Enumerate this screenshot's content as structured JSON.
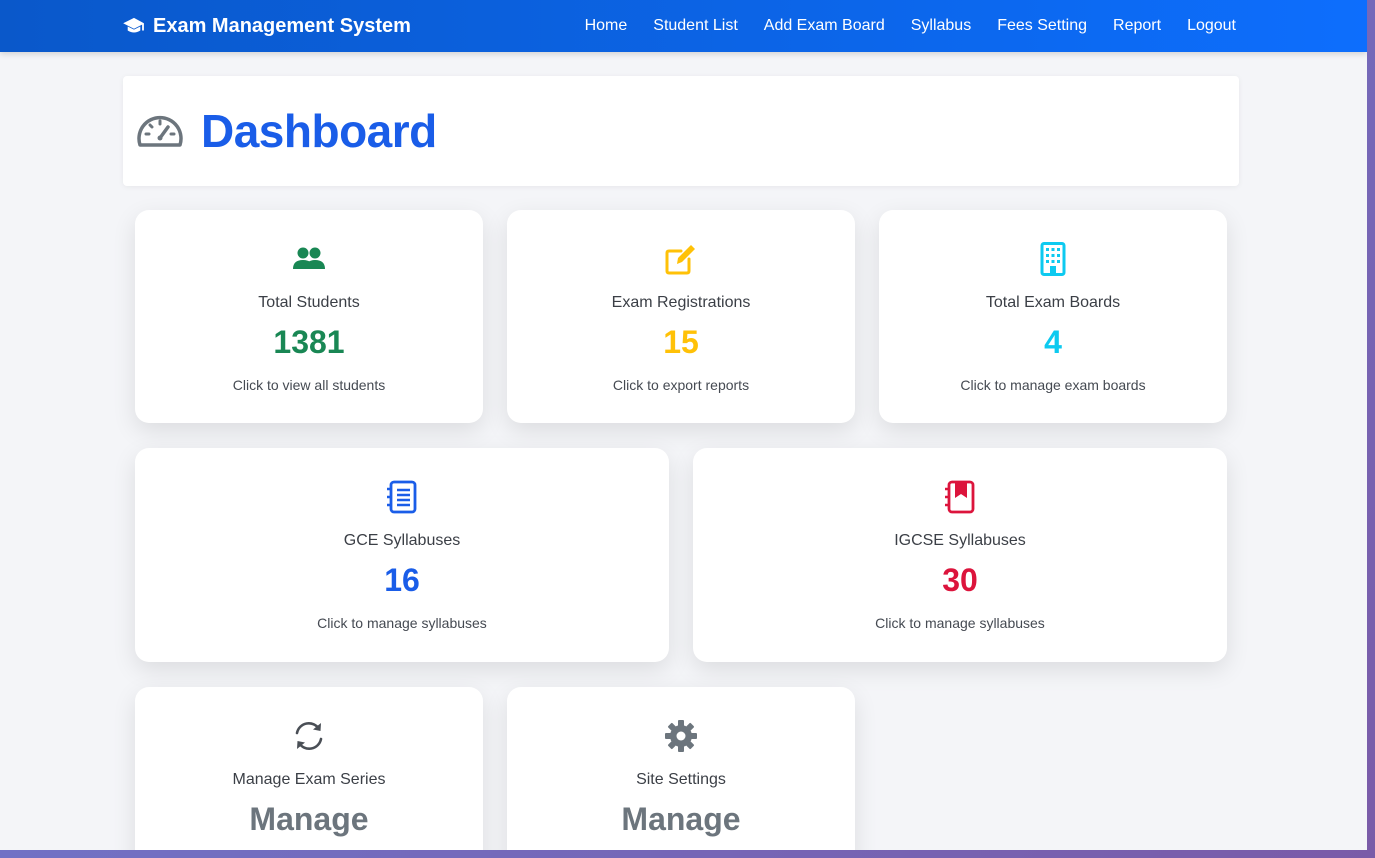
{
  "navbar": {
    "brand": "Exam Management System",
    "links": [
      "Home",
      "Student List",
      "Add Exam Board",
      "Syllabus",
      "Fees Setting",
      "Report",
      "Logout"
    ]
  },
  "header": {
    "title": "Dashboard"
  },
  "colors": {
    "primary": "#0d6efd",
    "green": "#198754",
    "yellow": "#ffc107",
    "cyan": "#0dcaf0",
    "blue": "#1a5de8",
    "red": "#dc143c",
    "gray": "#6c757d"
  },
  "cards": [
    {
      "icon": "users-icon",
      "label": "Total Students",
      "value": "1381",
      "hint": "Click to view all students"
    },
    {
      "icon": "edit-icon",
      "label": "Exam Registrations",
      "value": "15",
      "hint": "Click to export reports"
    },
    {
      "icon": "building-icon",
      "label": "Total Exam Boards",
      "value": "4",
      "hint": "Click to manage exam boards"
    },
    {
      "icon": "notebook-icon",
      "label": "GCE Syllabuses",
      "value": "16",
      "hint": "Click to manage syllabuses"
    },
    {
      "icon": "bookmark-notebook-icon",
      "label": "IGCSE Syllabuses",
      "value": "30",
      "hint": "Click to manage syllabuses"
    },
    {
      "icon": "sync-icon",
      "label": "Manage Exam Series",
      "value": "Manage"
    },
    {
      "icon": "gear-icon",
      "label": "Site Settings",
      "value": "Manage"
    }
  ]
}
